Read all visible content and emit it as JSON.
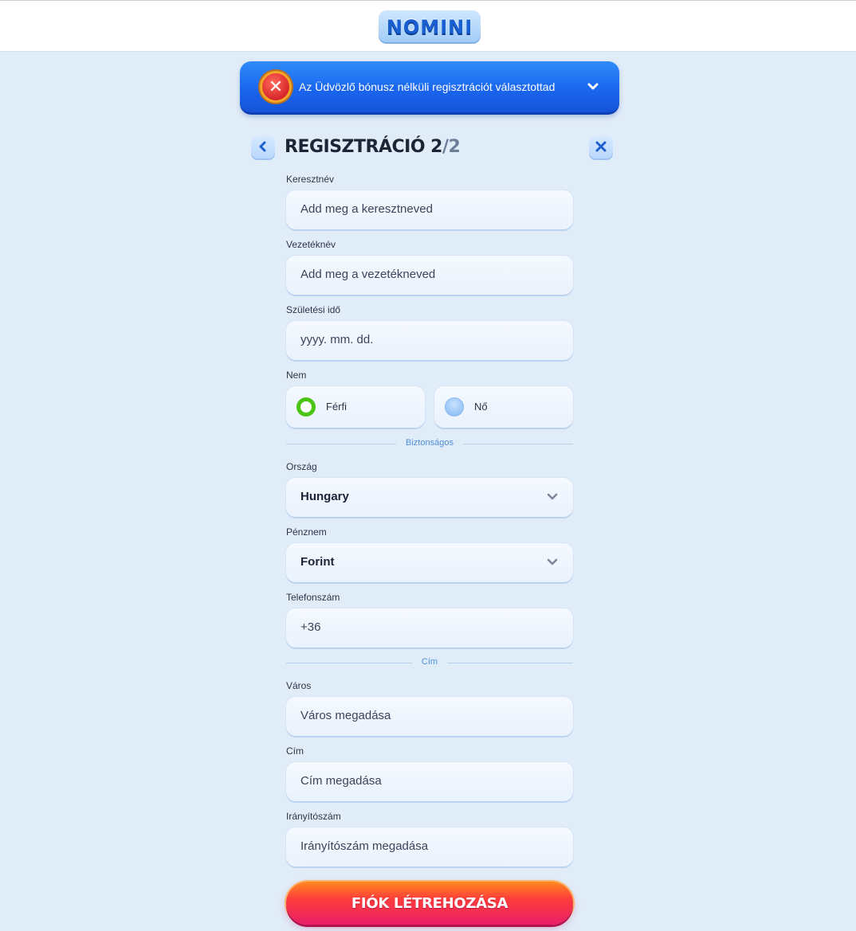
{
  "header": {
    "logo_text": "NOMINI"
  },
  "banner": {
    "text": "Az Üdvözlő bónusz nélküli regisztrációt választottad",
    "icon": "close-x-icon",
    "chevron_icon": "chevron-down-icon"
  },
  "form": {
    "title_main": "REGISZTRÁCIÓ 2",
    "title_total": "/2",
    "back_icon": "chevron-left-icon",
    "close_icon": "close-icon",
    "first_name": {
      "label": "Keresztnév",
      "placeholder": "Add meg a keresztneved"
    },
    "last_name": {
      "label": "Vezetéknév",
      "placeholder": "Add meg a vezetékneved"
    },
    "birth_date": {
      "label": "Születési idő",
      "placeholder": "yyyy. mm. dd."
    },
    "gender": {
      "label": "Nem",
      "options": [
        {
          "label": "Férfi",
          "selected": true
        },
        {
          "label": "Nő",
          "selected": false
        }
      ]
    },
    "divider_security": "Biztonságos",
    "country": {
      "label": "Ország",
      "value": "Hungary"
    },
    "currency": {
      "label": "Pénznem",
      "value": "Forint"
    },
    "phone": {
      "label": "Telefonszám",
      "value": "+36"
    },
    "divider_address": "Cím",
    "city": {
      "label": "Város",
      "placeholder": "Város megadása"
    },
    "address": {
      "label": "Cím",
      "placeholder": "Cím megadása"
    },
    "zip": {
      "label": "Irányítószám",
      "placeholder": "Irányítószám megadása"
    },
    "submit_label": "FIÓK LÉTREHOZÁSA"
  },
  "colors": {
    "page_bg": "#e1ecf9",
    "banner_blue": "#1a66ee",
    "radio_selected": "#4cc414",
    "divider_text": "#4c90dd",
    "submit_gradient_start": "#ff8a1f",
    "submit_gradient_end": "#e81f6a"
  }
}
